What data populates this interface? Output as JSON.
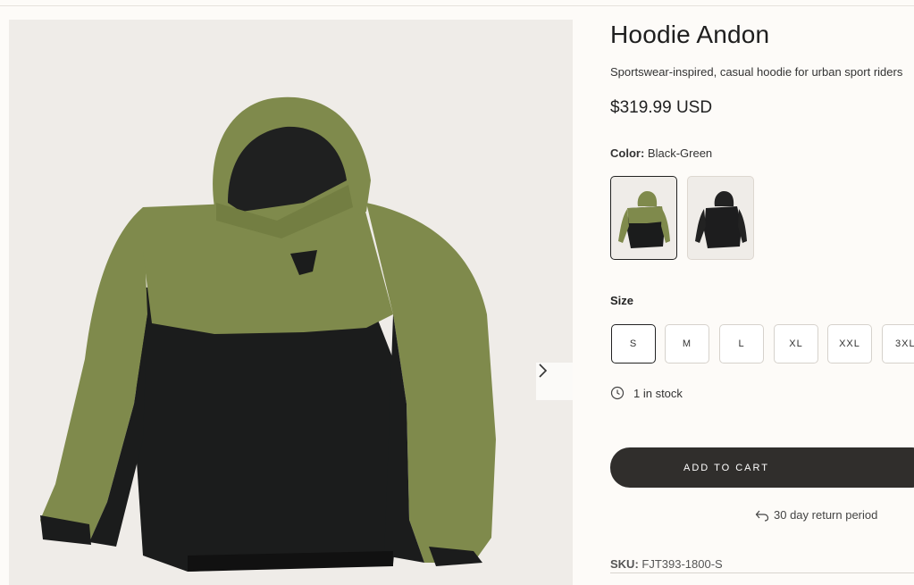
{
  "product": {
    "title": "Hoodie Andon",
    "subtitle": "Sportswear-inspired, casual hoodie for urban sport riders",
    "price": "$319.99 USD"
  },
  "color": {
    "label": "Color:",
    "value": "Black-Green",
    "options": [
      "Black-Green",
      "Black"
    ]
  },
  "size": {
    "label": "Size",
    "options": [
      "S",
      "M",
      "L",
      "XL",
      "XXL",
      "3XL"
    ],
    "selected": "S"
  },
  "stock": {
    "text": "1 in stock",
    "icon": "clock-icon"
  },
  "cart": {
    "button_label": "ADD TO CART"
  },
  "returns": {
    "text": "30 day return period",
    "icon": "return-arrow-icon"
  },
  "sku": {
    "label": "SKU:",
    "value": "FJT393-1800-S"
  },
  "colors": {
    "olive": "#7f8a4c",
    "black": "#1b1c1c",
    "button": "#302e2c",
    "background": "#fdfbf8"
  }
}
